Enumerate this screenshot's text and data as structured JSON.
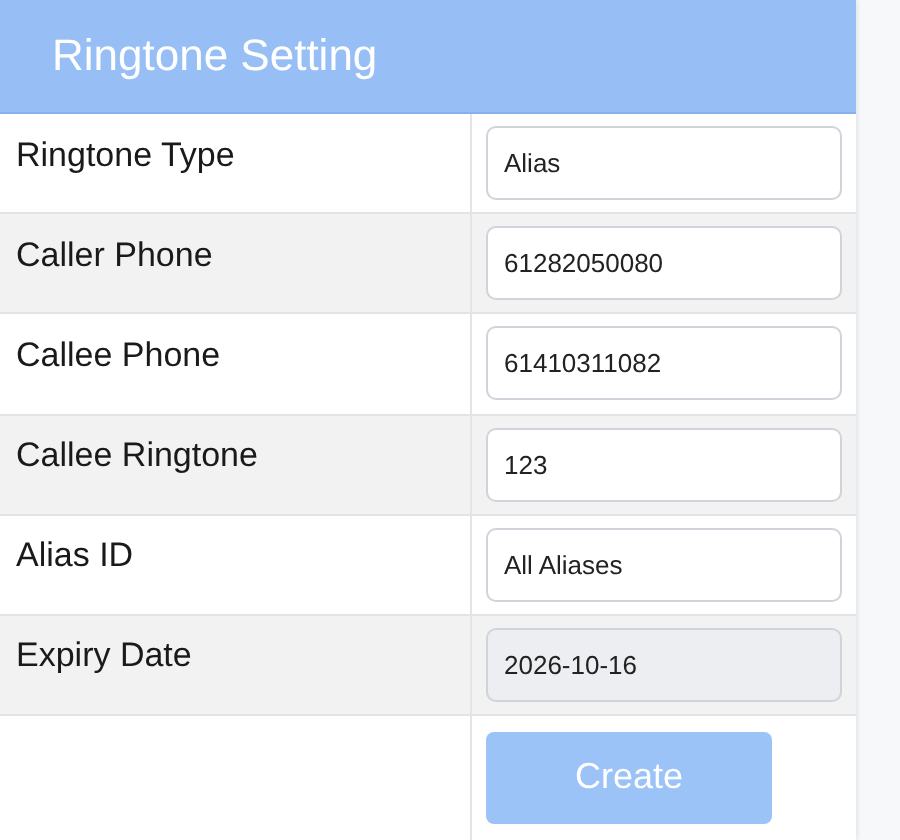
{
  "dialog": {
    "title": "Ringtone Setting",
    "fields": [
      {
        "label": "Ringtone Type",
        "value": "Alias",
        "readonly": false
      },
      {
        "label": "Caller Phone",
        "value": "61282050080",
        "readonly": false
      },
      {
        "label": "Callee Phone",
        "value": "61410311082",
        "readonly": false
      },
      {
        "label": "Callee Ringtone",
        "value": "123",
        "readonly": false
      },
      {
        "label": "Alias ID",
        "value": "All Aliases",
        "readonly": false
      },
      {
        "label": "Expiry Date",
        "value": "2026-10-16",
        "readonly": true
      }
    ],
    "button": {
      "label": "Create",
      "disabled": true
    }
  }
}
